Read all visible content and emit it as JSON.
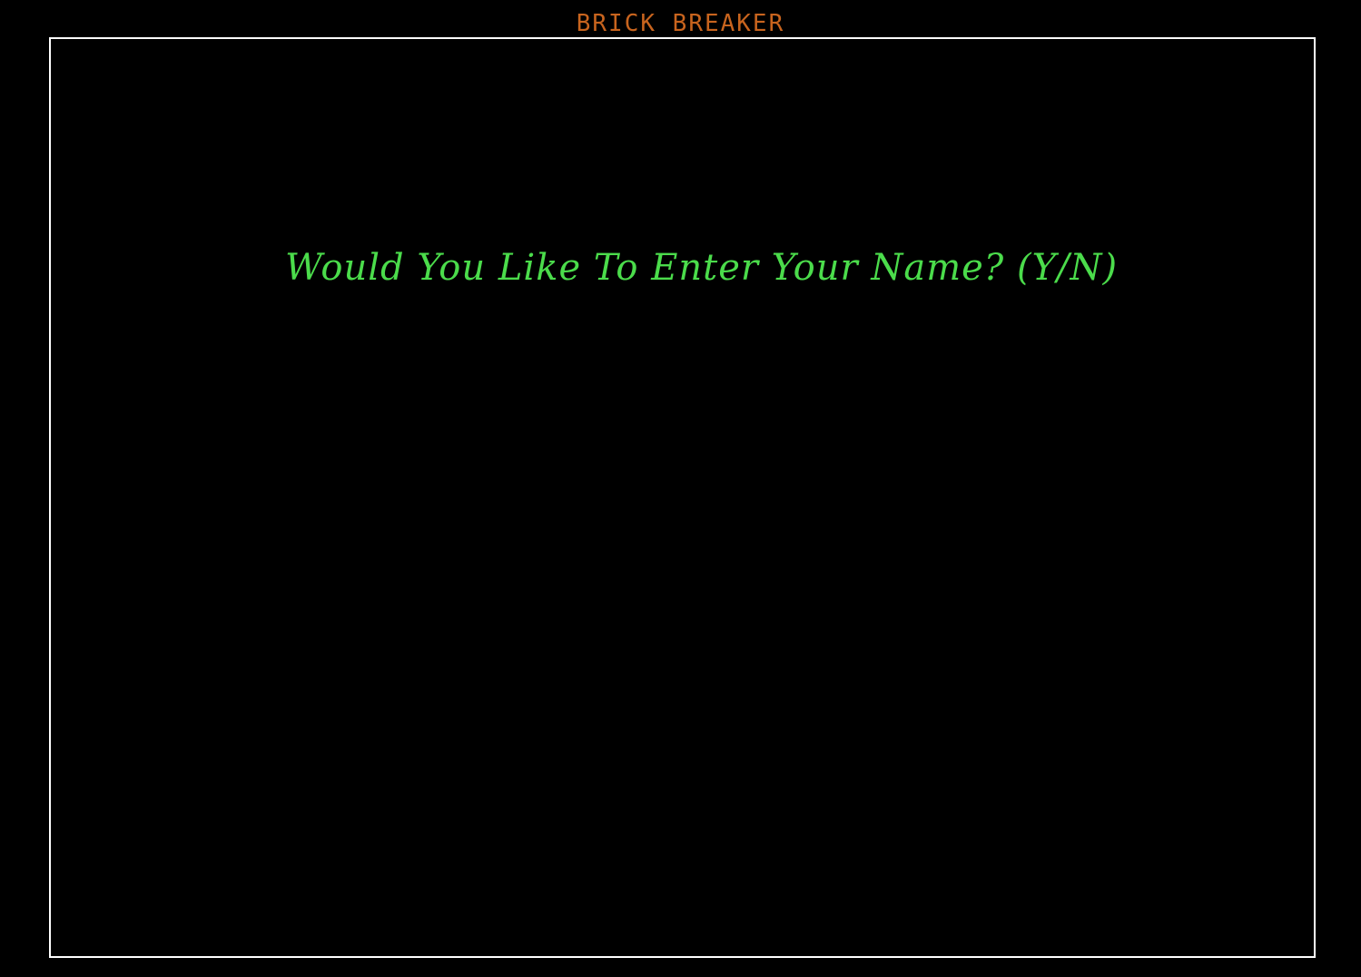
{
  "game": {
    "title": "BRICK BREAKER",
    "prompt": "Would You Like To Enter Your Name? (Y/N)"
  },
  "colors": {
    "background": "#000000",
    "title": "#c8641e",
    "border": "#ffffff",
    "prompt": "#4bdc4b"
  }
}
